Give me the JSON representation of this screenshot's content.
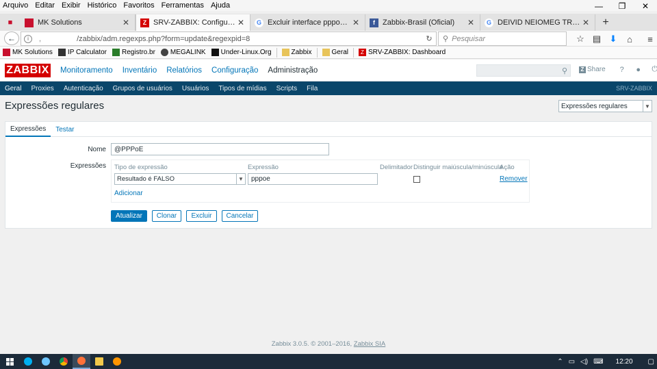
{
  "browser": {
    "menu": [
      "Arquivo",
      "Editar",
      "Exibir",
      "Histórico",
      "Favoritos",
      "Ferramentas",
      "Ajuda"
    ],
    "window_controls": [
      "—",
      "❐",
      "✕"
    ],
    "tabs": [
      {
        "label": "MK Solutions",
        "icon": "mk-flag-icon",
        "color": "#c8102e",
        "active": false
      },
      {
        "label": "SRV-ZABBIX: Configuraçã...",
        "icon": "zabbix-z-icon",
        "color": "#d40000",
        "active": true
      },
      {
        "label": "Excluir interface pppoe da ...",
        "icon": "google-g-icon",
        "color": "#4285f4",
        "active": false
      },
      {
        "label": "Zabbix-Brasil (Oficial)",
        "icon": "facebook-f-icon",
        "color": "#3b5998",
        "active": false
      },
      {
        "label": "DEIVID NEIOMEG TRASPA...",
        "icon": "google-g-icon",
        "color": "#4285f4",
        "active": false
      }
    ],
    "new_tab": "+",
    "url": "/zabbix/adm.regexps.php?form=update&regexpid=8",
    "search_placeholder": "Pesquisar",
    "bookmarks": [
      {
        "label": "MK Solutions",
        "icon": "mk-icon",
        "color": "#c8102e"
      },
      {
        "label": "IP Calculator",
        "icon": "ip-calc-icon",
        "color": "#333333"
      },
      {
        "label": "Registro.br",
        "icon": "registro-icon",
        "color": "#2a7d2a"
      },
      {
        "label": "MEGALINK",
        "icon": "megalink-icon",
        "color": "#444444"
      },
      {
        "label": "Under-Linux.Org",
        "icon": "underlinux-icon",
        "color": "#111111"
      },
      {
        "label": "Zabbix",
        "icon": "folder-icon",
        "color": "#e8c45a"
      },
      {
        "label": "Geral",
        "icon": "folder-icon",
        "color": "#e8c45a"
      },
      {
        "label": "SRV-ZABBIX: Dashboard",
        "icon": "zabbix-z-icon",
        "color": "#d40000"
      }
    ]
  },
  "zabbix": {
    "logo": "ZABBIX",
    "top_menu": [
      "Monitoramento",
      "Inventário",
      "Relatórios",
      "Configuração",
      "Administração"
    ],
    "top_menu_active": "Administração",
    "share_label": "Share",
    "sub_menu": [
      "Geral",
      "Proxies",
      "Autenticação",
      "Grupos de usuários",
      "Usuários",
      "Tipos de mídias",
      "Scripts",
      "Fila"
    ],
    "server_name": "SRV-ZABBIX",
    "page_title": "Expressões regulares",
    "page_select_value": "Expressões regulares",
    "tabs": [
      "Expressões",
      "Testar"
    ],
    "form": {
      "name_label": "Nome",
      "name_value": "@PPPoE",
      "expressions_label": "Expressões",
      "columns": [
        "Tipo de expressão",
        "Expressão",
        "Delimitador",
        "Distinguir maiúscula/minúscula",
        "Ação"
      ],
      "row": {
        "type": "Resultado é FALSO",
        "expression": "pppoe",
        "case_sensitive": false,
        "action": "Remover"
      },
      "add_link": "Adicionar"
    },
    "buttons": {
      "update": "Atualizar",
      "clone": "Clonar",
      "delete": "Excluir",
      "cancel": "Cancelar"
    },
    "footer": {
      "text": "Zabbix 3.0.5. © 2001–2016,",
      "link": "Zabbix SIA"
    }
  },
  "taskbar": {
    "clock": "12:20",
    "apps": [
      {
        "name": "skype-icon",
        "color": "#00aff0"
      },
      {
        "name": "chat-icon",
        "color": "#6ec6ff"
      },
      {
        "name": "chrome-icon",
        "color": "#f4b400"
      },
      {
        "name": "firefox-icon",
        "color": "#ff7139"
      },
      {
        "name": "file-explorer-icon",
        "color": "#f3c94b"
      },
      {
        "name": "firefox-dev-icon",
        "color": "#ff9500"
      }
    ]
  }
}
